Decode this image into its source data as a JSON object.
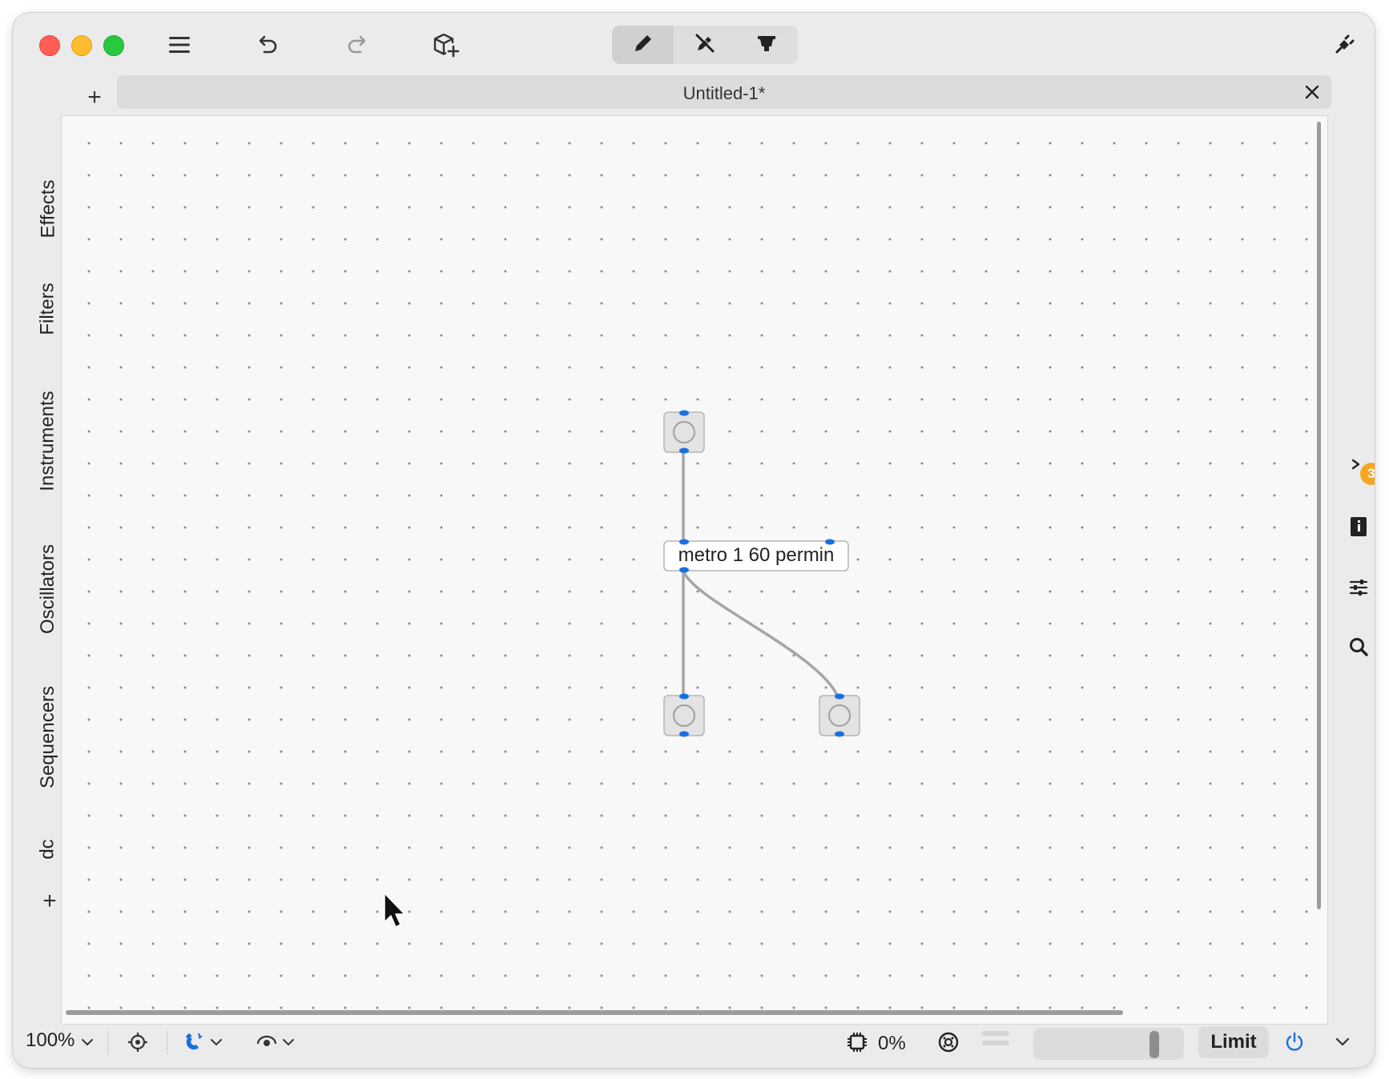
{
  "window": {
    "tab_title": "Untitled-1*",
    "tab_add_symbol": "+"
  },
  "icons": {
    "menu": "hamburger-icon",
    "undo": "undo-icon",
    "redo": "redo-icon",
    "add_object": "cube-add-icon",
    "edit_mode": "pencil-icon",
    "lock_mode": "no-edit-icon",
    "presentation_mode": "presentation-icon",
    "plugin": "plug-icon",
    "tab_close": "close-icon",
    "console": "console-icon",
    "info": "info-icon",
    "inspector": "sliders-icon",
    "search": "search-icon",
    "target": "crosshair-icon",
    "grid_snap": "magnet-icon",
    "pan": "eye-icon",
    "cpu": "cpu-icon",
    "audio": "speaker-icon",
    "power": "power-icon",
    "more": "chevron-down-icon"
  },
  "sidebar": {
    "categories": [
      "Effects",
      "Filters",
      "Instruments",
      "Oscillators",
      "Sequencers",
      "dc"
    ],
    "add_symbol": "+"
  },
  "right_sidebar": {
    "console_badge": "3"
  },
  "patch": {
    "metro_object": "metro 1 60 permin"
  },
  "statusbar": {
    "zoom": "100%",
    "cpu": "0%",
    "limit_label": "Limit",
    "volume_level": 0.85
  },
  "colors": {
    "accent": "#1a6fe0",
    "inlet": "#1a6fe0",
    "badge": "#f6a623",
    "traffic_red": "#ff5f57",
    "traffic_yellow": "#febc2e",
    "traffic_green": "#28c840"
  }
}
